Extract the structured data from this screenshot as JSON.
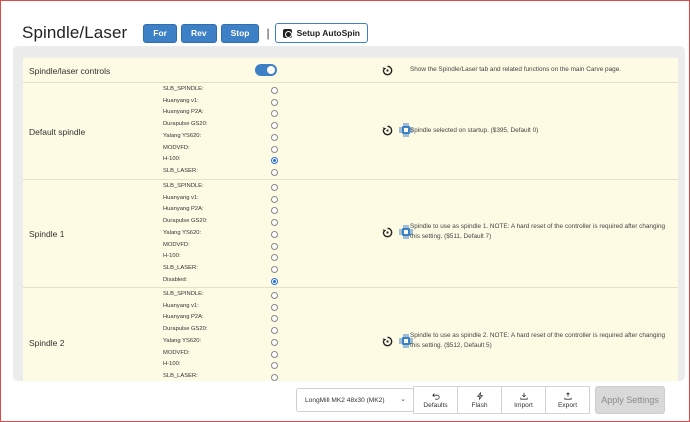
{
  "header": {
    "title": "Spindle/Laser",
    "buttons": {
      "forward": "For",
      "reverse": "Rev",
      "stop": "Stop"
    },
    "separator": "|",
    "autospin": "Setup AutoSpin"
  },
  "settings": {
    "controls": {
      "label": "Spindle/laser controls",
      "enabled": true,
      "description": "Show the Spindle/Laser tab and related functions on the main Carve page."
    },
    "default_spindle": {
      "label": "Default spindle",
      "options": [
        "SLB_SPINDLE:",
        "Huanyang v1:",
        "Huanyang P2A:",
        "Durapulse GS20:",
        "Yalang YS620:",
        "MODVFD:",
        "H-100:",
        "SLB_LASER:"
      ],
      "selected": 6,
      "description": "Spindle selected on startup. ($395, Default 0)"
    },
    "spindle1": {
      "label": "Spindle 1",
      "options": [
        "SLB_SPINDLE:",
        "Huanyang v1:",
        "Huanyang P2A:",
        "Durapulse GS20:",
        "Yalang YS620:",
        "MODVFD:",
        "H-100:",
        "SLB_LASER:",
        "Disabled:"
      ],
      "selected": 8,
      "description": "Spindle to use as spindle 1. NOTE: A hard reset of the controller is required after changing this setting. ($511, Default 7)"
    },
    "spindle2": {
      "label": "Spindle 2",
      "options": [
        "SLB_SPINDLE:",
        "Huanyang v1:",
        "Huanyang P2A:",
        "Durapulse GS20:",
        "Yalang YS620:",
        "MODVFD:",
        "H-100:",
        "SLB_LASER:"
      ],
      "selected": -1,
      "description": "Spindle to use as spindle 2. NOTE: A hard reset of the controller is required after changing this setting. ($512, Default 5)"
    }
  },
  "footer": {
    "profile": "LongMill MK2 48x30 (MK2)",
    "defaults": "Defaults",
    "flash": "Flash",
    "import": "Import",
    "export": "Export",
    "apply": "Apply Settings"
  },
  "icons": {
    "reset": "reset-icon",
    "chip": "chip-icon",
    "chevron": "chevron-down-icon"
  },
  "colors": {
    "accent": "#3d80c6",
    "row_bg": "#fdfbe4",
    "panel_bg": "#ececec"
  }
}
